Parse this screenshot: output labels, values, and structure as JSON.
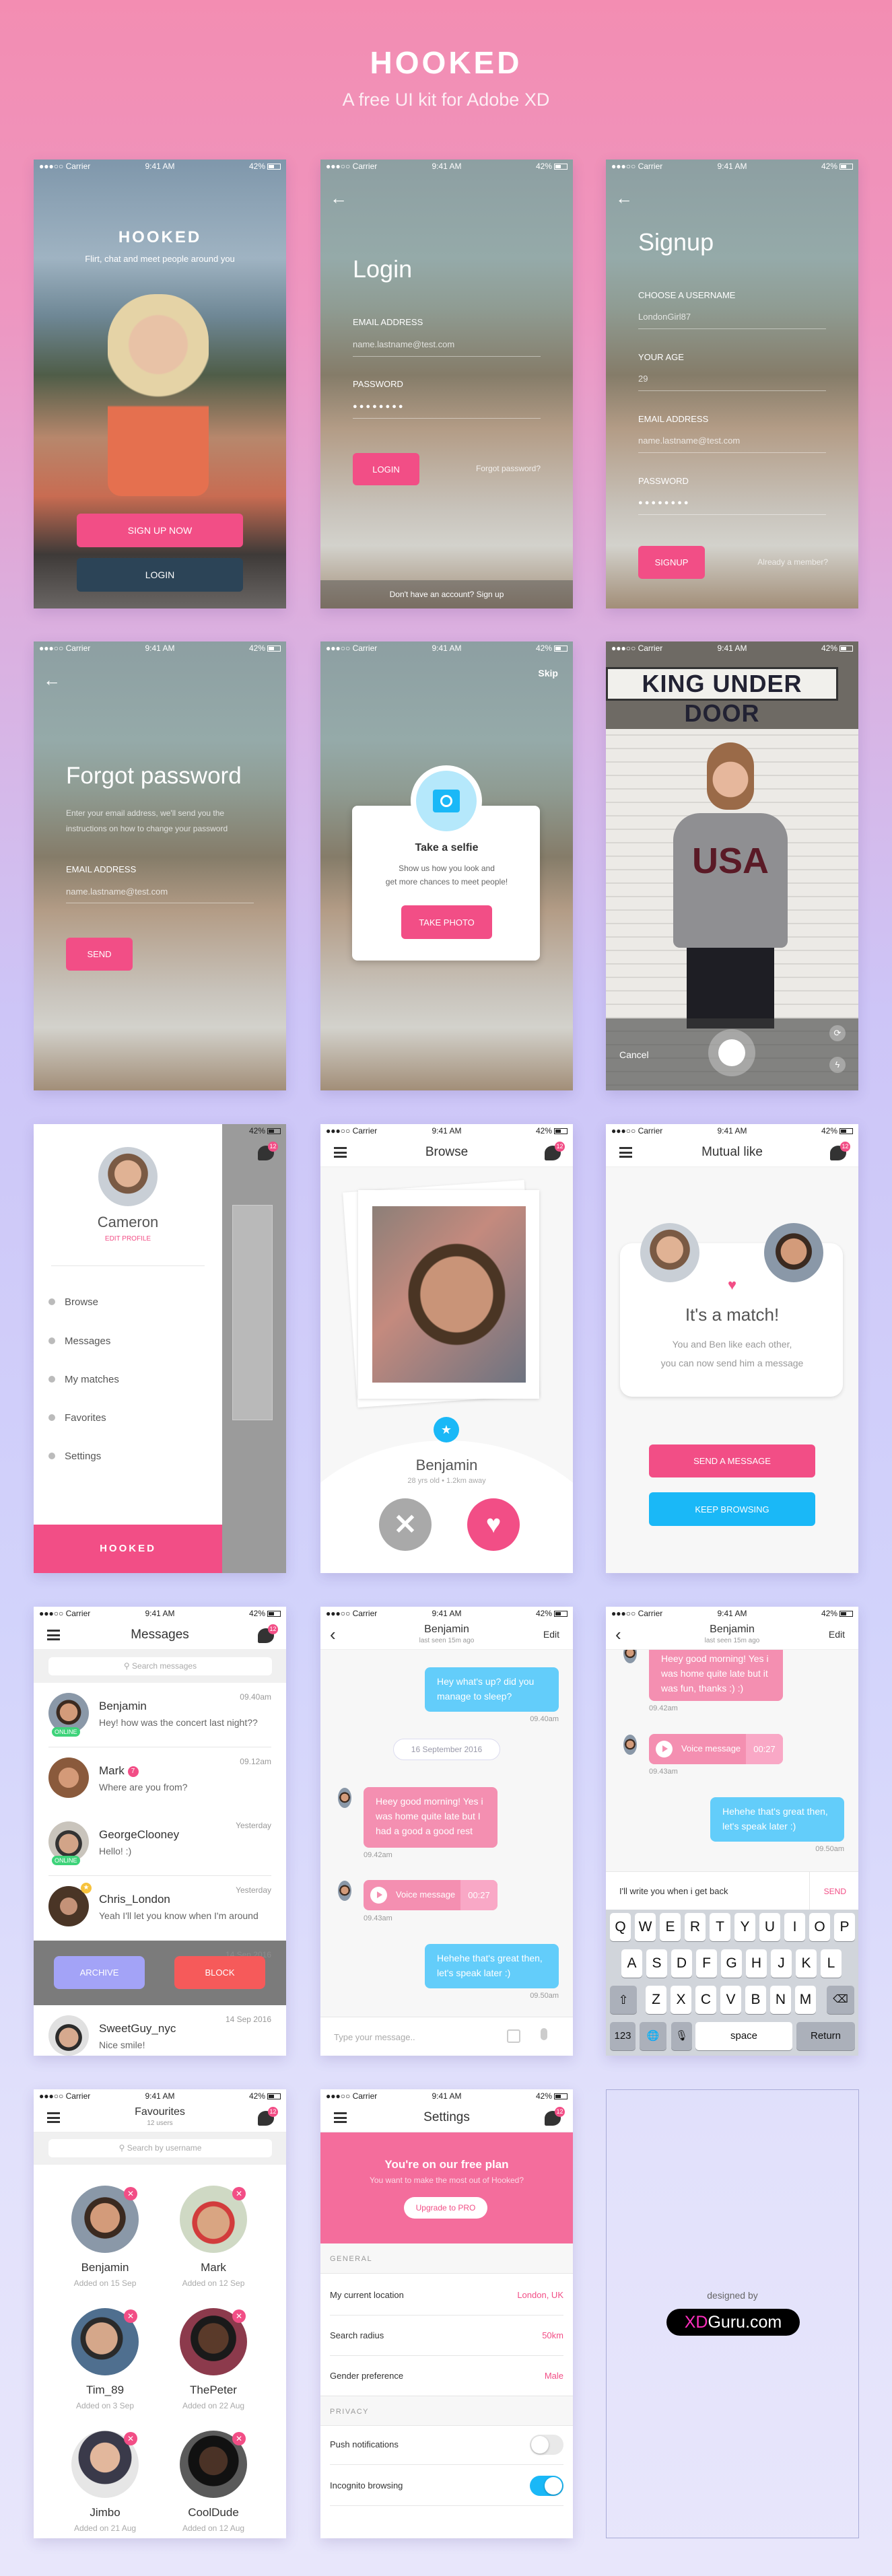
{
  "header": {
    "title": "HOOKED",
    "subtitle": "A free UI kit for Adobe XD"
  },
  "status": {
    "carrier": "●●●○○ Carrier",
    "time": "9:41 AM",
    "battery": "42%"
  },
  "colors": {
    "accent_pink": "#f24e86",
    "accent_blue": "#1ab8f7",
    "dark_button": "#2c4457",
    "online_green": "#3ed37a"
  },
  "splash": {
    "brand": "HOOKED",
    "tagline": "Flirt, chat and meet people around you",
    "signup_button": "SIGN UP NOW",
    "login_button": "LOGIN"
  },
  "login": {
    "title": "Login",
    "email_label": "EMAIL ADDRESS",
    "email_value": "name.lastname@test.com",
    "password_label": "PASSWORD",
    "password_value": "● ● ● ● ● ● ● ●",
    "login_button": "LOGIN",
    "forgot_link": "Forgot password?",
    "footer": "Don't have an account? Sign up"
  },
  "signup": {
    "title": "Signup",
    "username_label": "CHOOSE A USERNAME",
    "username_value": "LondonGirl87",
    "age_label": "YOUR AGE",
    "age_value": "29",
    "email_label": "EMAIL ADDRESS",
    "email_value": "name.lastname@test.com",
    "password_label": "PASSWORD",
    "password_value": "● ● ● ● ● ● ● ●",
    "signup_button": "SIGNUP",
    "member_link": "Already a member?"
  },
  "forgot": {
    "title": "Forgot password",
    "description_1": "Enter your email address, we'll send you the",
    "description_2": "instructions on how to change your password",
    "email_label": "EMAIL ADDRESS",
    "email_value": "name.lastname@test.com",
    "send_button": "SEND"
  },
  "selfie": {
    "skip": "Skip",
    "title": "Take a selfie",
    "text_1": "Show us how you look and",
    "text_2": "get more chances to meet people!",
    "button": "TAKE PHOTO"
  },
  "camera": {
    "sign_text": "KING UNDER DOOR",
    "shirt_text": "USA",
    "cancel": "Cancel"
  },
  "menu": {
    "name": "Cameron",
    "edit_profile": "EDIT PROFILE",
    "items": [
      {
        "label": "Browse"
      },
      {
        "label": "Messages"
      },
      {
        "label": "My matches"
      },
      {
        "label": "Favorites"
      },
      {
        "label": "Settings"
      }
    ],
    "footer": "HOOKED",
    "badge": "12"
  },
  "browse": {
    "title": "Browse",
    "badge": "12",
    "name": "Benjamin",
    "meta": "28 yrs old • 1.2km away"
  },
  "match": {
    "title": "Mutual like",
    "badge": "12",
    "headline": "It's a match!",
    "line_1": "You and Ben like each other,",
    "line_2": "you can now send him a message",
    "send_button": "SEND A MESSAGE",
    "keep_button": "KEEP BROWSING"
  },
  "messages": {
    "title": "Messages",
    "badge": "12",
    "search_placeholder": "Search messages",
    "conversations": [
      {
        "name": "Benjamin",
        "text": "Hey! how was the concert last night??",
        "time": "09.40am",
        "status": "ONLINE"
      },
      {
        "name": "Mark",
        "text": "Where are you from?",
        "time": "09.12am",
        "unread": "7"
      },
      {
        "name": "GeorgeClooney",
        "text": "Hello! :)",
        "time": "Yesterday",
        "status": "ONLINE"
      },
      {
        "name": "Chris_London",
        "text": "Yeah I'll let you know when I'm around",
        "time": "Yesterday"
      },
      {
        "name": "SweetGuy_nyc",
        "text": "Nice smile!",
        "time": "14 Sep 2016"
      }
    ],
    "swiped_time": "14 Sep 2016",
    "archive_button": "ARCHIVE",
    "block_button": "BLOCK"
  },
  "chat": {
    "name": "Benjamin",
    "last_seen": "last seen 15m ago",
    "edit": "Edit",
    "msg_1": "Hey what's up? did you manage to sleep?",
    "time_1": "09.40am",
    "date": "16 September 2016",
    "msg_2": "Heey good morning! Yes i was home quite late but I had a good a good rest",
    "time_2": "09.42am",
    "voice_label": "Voice message",
    "voice_duration": "00:27",
    "time_3": "09.43am",
    "msg_4": "Hehehe that's great then, let's speak later :)",
    "time_4": "09.50am",
    "input_placeholder": "Type your message.."
  },
  "chat_keyboard": {
    "name": "Benjamin",
    "last_seen": "last seen 15m ago",
    "edit": "Edit",
    "msg_2": "Heey good morning! Yes i was home quite late but it was fun, thanks :) :)",
    "time_2": "09.42am",
    "voice_label": "Voice message",
    "voice_duration": "00:27",
    "time_3": "09.43am",
    "msg_4": "Hehehe that's great then, let's speak later :)",
    "time_4": "09.50am",
    "draft": "I'll write you when i get back",
    "send": "SEND",
    "row_1": [
      "Q",
      "W",
      "E",
      "R",
      "T",
      "Y",
      "U",
      "I",
      "O",
      "P"
    ],
    "row_2": [
      "A",
      "S",
      "D",
      "F",
      "G",
      "H",
      "J",
      "K",
      "L"
    ],
    "row_3": [
      "Z",
      "X",
      "C",
      "V",
      "B",
      "N",
      "M"
    ],
    "numbers_key": "123",
    "space_key": "space",
    "return_key": "Return"
  },
  "favourites": {
    "title": "Favourites",
    "count": "12 users",
    "badge": "12",
    "search_placeholder": "Search by username",
    "users": [
      {
        "name": "Benjamin",
        "added": "Added on 15 Sep"
      },
      {
        "name": "Mark",
        "added": "Added on 12 Sep"
      },
      {
        "name": "Tim_89",
        "added": "Added on 3 Sep"
      },
      {
        "name": "ThePeter",
        "added": "Added on 22 Aug"
      },
      {
        "name": "Jimbo",
        "added": "Added on 21 Aug"
      },
      {
        "name": "CoolDude",
        "added": "Added on 12 Aug"
      }
    ]
  },
  "settings": {
    "title": "Settings",
    "badge": "12",
    "banner_title": "You're on our free plan",
    "banner_subtitle": "You want to make the most out of Hooked?",
    "upgrade_button": "Upgrade to PRO",
    "general_label": "GENERAL",
    "rows": [
      {
        "label": "My current location",
        "value": "London, UK"
      },
      {
        "label": "Search radius",
        "value": "50km"
      },
      {
        "label": "Gender preference",
        "value": "Male"
      }
    ],
    "privacy_label": "PRIVACY",
    "toggles": [
      {
        "label": "Push notifications",
        "on": false
      },
      {
        "label": "Incognito browsing",
        "on": true
      }
    ]
  },
  "credit": {
    "designed_by": "designed by",
    "brand_xd": "XD",
    "brand_rest": "Guru.com"
  }
}
